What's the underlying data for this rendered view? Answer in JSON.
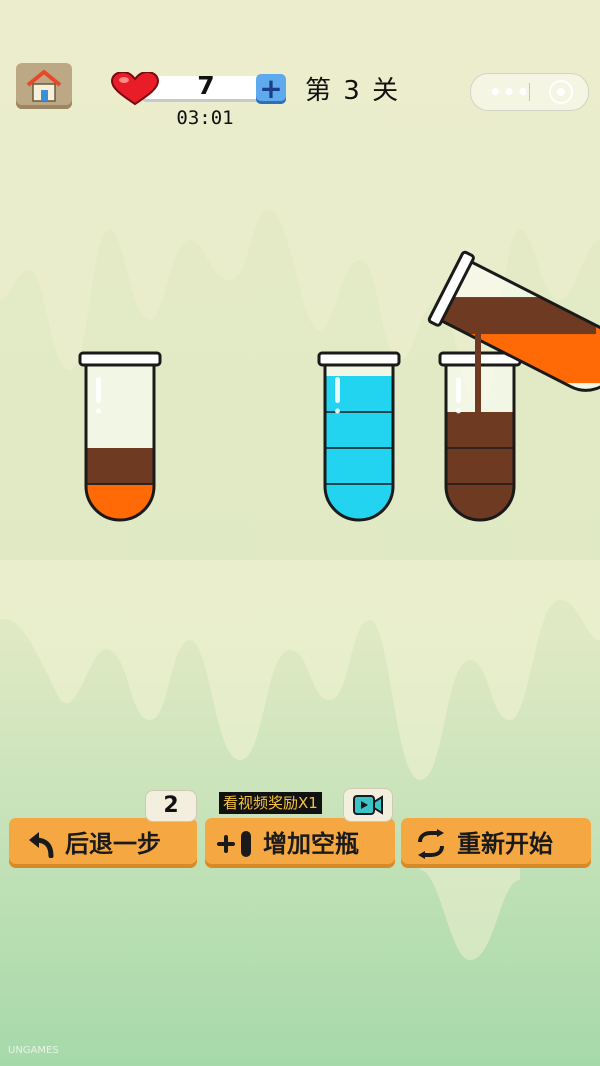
{
  "top_bar": {
    "lives": "7",
    "timer": "03:01",
    "level": "第 3 关",
    "menu_dots": "•••"
  },
  "tubes": [
    {
      "layers": [
        "#ff6a06",
        "#6e3a22"
      ]
    },
    {
      "layers": [
        "#22d4ef",
        "#22d4ef",
        "#22d4ef",
        "#22d4ef"
      ]
    },
    {
      "layers": [
        "#6e3a22",
        "#6e3a22",
        "#6e3a22"
      ]
    }
  ],
  "pouring_tube": {
    "layers": [
      "#ff6a06",
      "#ff6a06",
      "#ff6a06",
      "#6e3a22"
    ]
  },
  "colors": {
    "orange": "#ff6a06",
    "brown": "#6e3a22",
    "cyan": "#22d4ef",
    "button": "#f5a841"
  },
  "actions": {
    "undo": {
      "label": "后退一步",
      "count": "2"
    },
    "add_bottle": {
      "label": "增加空瓶",
      "video_tag": "看视频奖励X1"
    },
    "restart": {
      "label": "重新开始"
    }
  },
  "watermark": "UNGAMES"
}
